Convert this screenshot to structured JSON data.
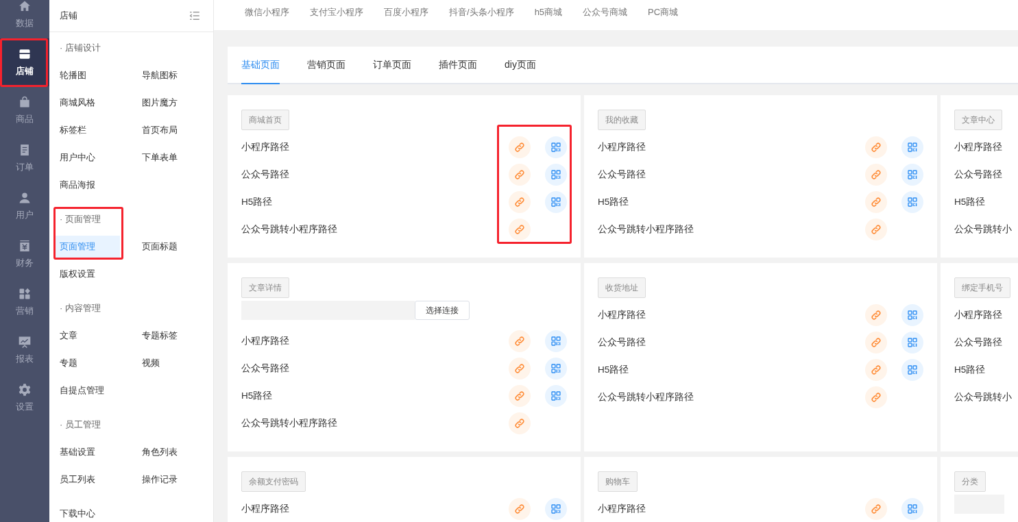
{
  "rail": [
    {
      "label": "数据",
      "selected": false,
      "highlighted": false
    },
    {
      "label": "店铺",
      "selected": true,
      "highlighted": true
    },
    {
      "label": "商品",
      "selected": false,
      "highlighted": false
    },
    {
      "label": "订单",
      "selected": false,
      "highlighted": false
    },
    {
      "label": "用户",
      "selected": false,
      "highlighted": false
    },
    {
      "label": "财务",
      "selected": false,
      "highlighted": false
    },
    {
      "label": "营销",
      "selected": false,
      "highlighted": false
    },
    {
      "label": "报表",
      "selected": false,
      "highlighted": false
    },
    {
      "label": "设置",
      "selected": false,
      "highlighted": false
    }
  ],
  "sidebar": {
    "title": "店铺",
    "groups": [
      {
        "title": "· 店铺设计",
        "highlighted": false,
        "items": [
          {
            "label": "轮播图",
            "selected": false
          },
          {
            "label": "导航图标",
            "selected": false
          },
          {
            "label": "商城风格",
            "selected": false
          },
          {
            "label": "图片魔方",
            "selected": false
          },
          {
            "label": "标签栏",
            "selected": false
          },
          {
            "label": "首页布局",
            "selected": false
          },
          {
            "label": "用户中心",
            "selected": false
          },
          {
            "label": "下单表单",
            "selected": false
          },
          {
            "label": "商品海报",
            "selected": false
          }
        ]
      },
      {
        "title": "· 页面管理",
        "highlighted": true,
        "items": [
          {
            "label": "页面管理",
            "selected": true
          },
          {
            "label": "页面标题",
            "selected": false
          },
          {
            "label": "版权设置",
            "selected": false
          }
        ]
      },
      {
        "title": "· 内容管理",
        "highlighted": false,
        "items": [
          {
            "label": "文章",
            "selected": false
          },
          {
            "label": "专题标签",
            "selected": false
          },
          {
            "label": "专题",
            "selected": false
          },
          {
            "label": "视频",
            "selected": false
          },
          {
            "label": "自提点管理",
            "selected": false
          }
        ]
      },
      {
        "title": "· 员工管理",
        "highlighted": false,
        "items": [
          {
            "label": "基础设置",
            "selected": false
          },
          {
            "label": "角色列表",
            "selected": false
          },
          {
            "label": "员工列表",
            "selected": false
          },
          {
            "label": "操作记录",
            "selected": false
          }
        ]
      },
      {
        "highlighted": false,
        "items": [
          {
            "label": "下载中心",
            "selected": false
          }
        ]
      }
    ]
  },
  "platforms": [
    {
      "label": "微信小程序",
      "selected": false
    },
    {
      "label": "支付宝小程序",
      "selected": false
    },
    {
      "label": "百度小程序",
      "selected": false
    },
    {
      "label": "抖音/头条小程序",
      "selected": false
    },
    {
      "label": "h5商城",
      "selected": false
    },
    {
      "label": "公众号商城",
      "selected": false
    },
    {
      "label": "PC商城",
      "selected": false
    }
  ],
  "page_tabs": [
    {
      "label": "基础页面",
      "selected": true
    },
    {
      "label": "营销页面",
      "selected": false
    },
    {
      "label": "订单页面",
      "selected": false
    },
    {
      "label": "插件页面",
      "selected": false
    },
    {
      "label": "diy页面",
      "selected": false
    }
  ],
  "cards": [
    {
      "title": "商城首页",
      "kind": "paths",
      "highlighted": true,
      "rows": [
        {
          "label": "小程序路径",
          "link": true,
          "qr": true
        },
        {
          "label": "公众号路径",
          "link": true,
          "qr": true
        },
        {
          "label": "H5路径",
          "link": true,
          "qr": true
        },
        {
          "label": "公众号跳转小程序路径",
          "link": true,
          "qr": false
        }
      ]
    },
    {
      "title": "我的收藏",
      "kind": "paths",
      "highlighted": false,
      "rows": [
        {
          "label": "小程序路径",
          "link": true,
          "qr": true
        },
        {
          "label": "公众号路径",
          "link": true,
          "qr": true
        },
        {
          "label": "H5路径",
          "link": true,
          "qr": true
        },
        {
          "label": "公众号跳转小程序路径",
          "link": true,
          "qr": false
        }
      ]
    },
    {
      "title": "文章中心",
      "kind": "paths",
      "highlighted": false,
      "rows": [
        {
          "label": "小程序路径"
        },
        {
          "label": "公众号路径"
        },
        {
          "label": "H5路径"
        },
        {
          "label": "公众号跳转小"
        }
      ]
    },
    {
      "title": "文章详情",
      "kind": "picker",
      "highlighted": false,
      "button": "选择连接",
      "rows": [
        {
          "label": "小程序路径",
          "link": true,
          "qr": true
        },
        {
          "label": "公众号路径",
          "link": true,
          "qr": true
        },
        {
          "label": "H5路径",
          "link": true,
          "qr": true
        },
        {
          "label": "公众号跳转小程序路径",
          "link": true,
          "qr": false
        }
      ]
    },
    {
      "title": "收货地址",
      "kind": "paths",
      "highlighted": false,
      "rows": [
        {
          "label": "小程序路径",
          "link": true,
          "qr": true
        },
        {
          "label": "公众号路径",
          "link": true,
          "qr": true
        },
        {
          "label": "H5路径",
          "link": true,
          "qr": true
        },
        {
          "label": "公众号跳转小程序路径",
          "link": true,
          "qr": false
        }
      ]
    },
    {
      "title": "绑定手机号",
      "kind": "paths",
      "highlighted": false,
      "rows": [
        {
          "label": "小程序路径"
        },
        {
          "label": "公众号路径"
        },
        {
          "label": "H5路径"
        },
        {
          "label": "公众号跳转小"
        }
      ]
    },
    {
      "title": "余额支付密码",
      "kind": "paths",
      "highlighted": false,
      "rows": [
        {
          "label": "小程序路径",
          "link": true,
          "qr": true
        }
      ]
    },
    {
      "title": "购物车",
      "kind": "paths",
      "highlighted": false,
      "rows": [
        {
          "label": "小程序路径",
          "link": true,
          "qr": true
        }
      ]
    },
    {
      "title": "分类",
      "kind": "picker",
      "highlighted": false
    }
  ]
}
